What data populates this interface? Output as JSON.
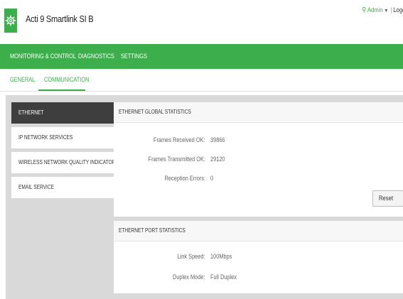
{
  "header": {
    "title": "Acti 9 Smartlink SI B",
    "user": "Admin",
    "logout": "Logo"
  },
  "main_nav": {
    "items": [
      {
        "label": "MONITORING & CONTROL"
      },
      {
        "label": "DIAGNOSTICS"
      },
      {
        "label": "SETTINGS"
      }
    ]
  },
  "sub_nav": {
    "items": [
      {
        "label": "GENERAL"
      },
      {
        "label": "COMMUNICATION"
      }
    ]
  },
  "sidebar": {
    "items": [
      {
        "label": "ETHERNET"
      },
      {
        "label": "IP NETWORK SERVICES"
      },
      {
        "label": "WIRELESS NETWORK QUALITY INDICATORS"
      },
      {
        "label": "EMAIL SERVICE"
      }
    ]
  },
  "global_stats": {
    "title": "ETHERNET GLOBAL STATISTICS",
    "rows": [
      {
        "label": "Frames Received OK:",
        "value": "39866"
      },
      {
        "label": "Frames Transmitted OK:",
        "value": "29120"
      },
      {
        "label": "Reception Errors:",
        "value": "0"
      }
    ],
    "reset_label": "Reset"
  },
  "port_stats": {
    "title": "ETHERNET PORT STATISTICS",
    "rows": [
      {
        "label": "Link Speed:",
        "value": "100Mbps"
      },
      {
        "label": "Duplex Mode:",
        "value": "Full Duplex"
      }
    ]
  },
  "colors": {
    "brand_green": "#3dae4c",
    "active_sidebar": "#3e3e3e",
    "content_bg": "#d9d9d9"
  }
}
